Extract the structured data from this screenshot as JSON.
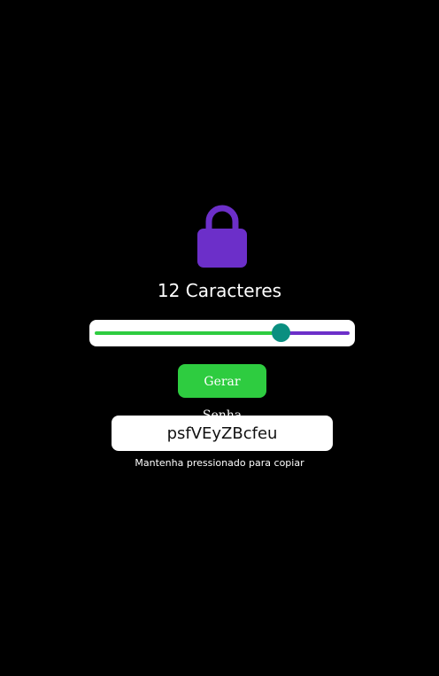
{
  "header": {
    "icon": "lock-icon",
    "title": "12 Caracteres"
  },
  "slider": {
    "value_fraction": 0.73
  },
  "actions": {
    "generate_label": "Gerar Senha"
  },
  "result": {
    "password": "psfVEyZBcfeu",
    "hint": "Mantenha pressionado para copiar"
  },
  "colors": {
    "background": "#000000",
    "accent_purple": "#6c2fc9",
    "accent_green": "#2ecc40",
    "thumb_teal": "#0a8f80",
    "button_green": "#2ecc40"
  }
}
